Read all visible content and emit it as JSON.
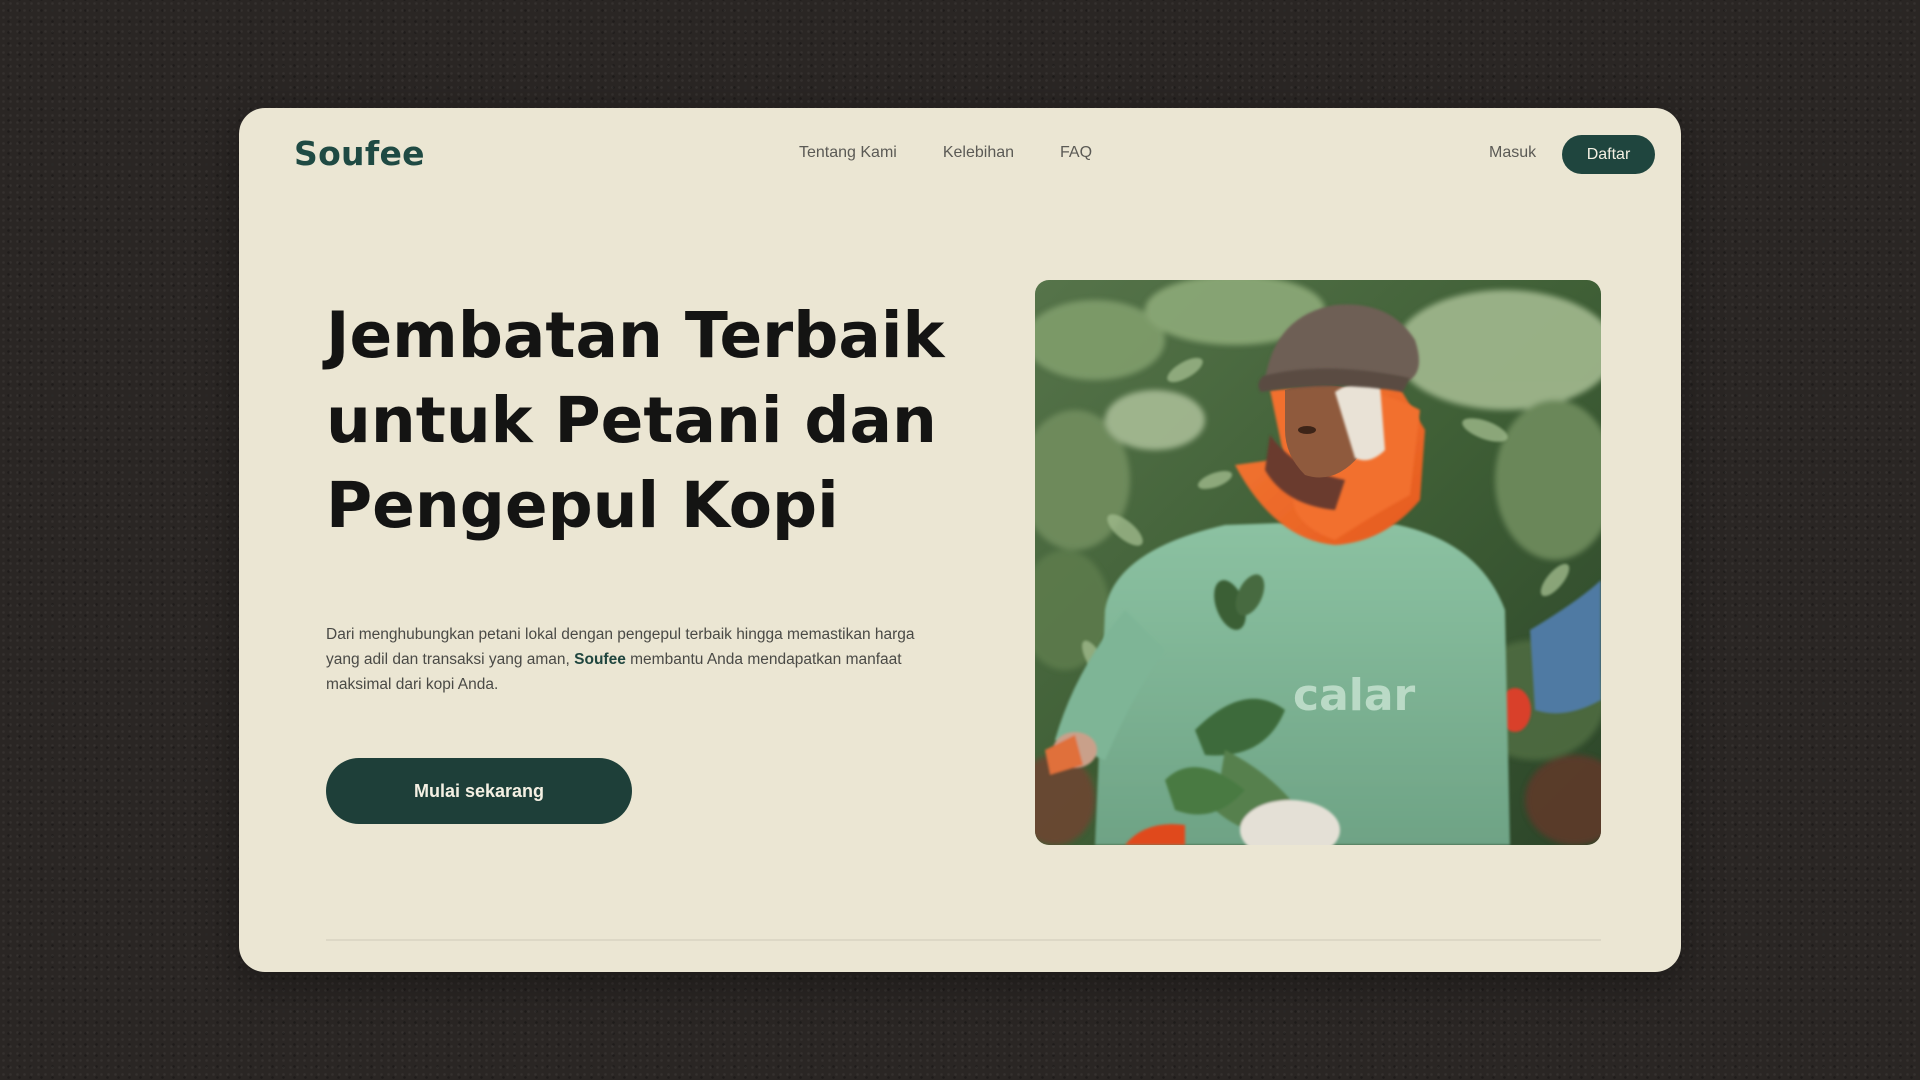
{
  "brand": {
    "name": "Soufee",
    "color": "#1f453e"
  },
  "nav": {
    "items": [
      {
        "label": "Tentang Kami"
      },
      {
        "label": "Kelebihan"
      },
      {
        "label": "FAQ"
      }
    ],
    "login_label": "Masuk",
    "signup_label": "Daftar"
  },
  "hero": {
    "title_lines": [
      "Jembatan Terbaik",
      "untuk Petani dan",
      "Pengepul Kopi"
    ],
    "description_before": "Dari menghubungkan petani lokal dengan pengepul terbaik hingga memastikan harga yang adil dan transaksi yang aman, ",
    "description_brand": "Soufee",
    "description_after": " membantu Anda mendapatkan manfaat maksimal dari kopi Anda.",
    "cta_label": "Mulai sekarang",
    "image": {
      "shirt_text": "calar",
      "colors": {
        "background": "#ebe6d3",
        "foliage": "#4b6a3c",
        "shirt": "#7fb597",
        "scarf": "#f06b2a",
        "cap": "#6e5f55"
      }
    }
  }
}
